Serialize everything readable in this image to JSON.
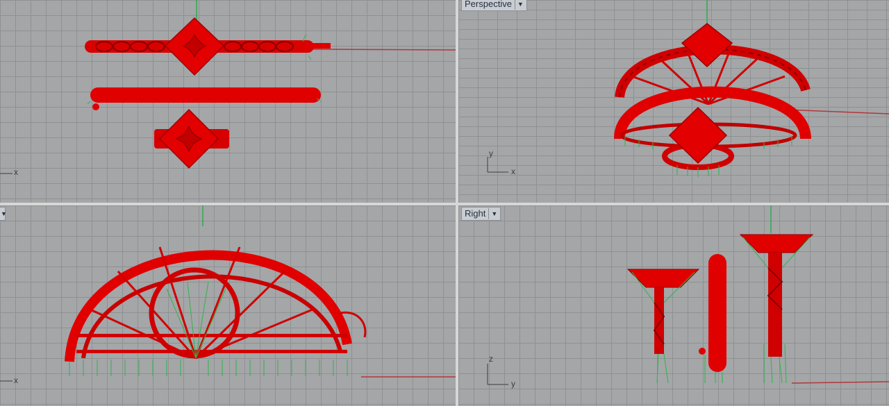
{
  "viewports": {
    "top": {
      "label": "",
      "axis_x": "x"
    },
    "perspective": {
      "label": "Perspective",
      "axis_x": "x",
      "axis_y": "y"
    },
    "front": {
      "label": "",
      "axis_x": "x"
    },
    "right": {
      "label": "Right",
      "axis_z": "z",
      "axis_y": "y"
    }
  },
  "icons": {
    "viewport_menu": "chevron-down-icon"
  },
  "colors": {
    "model": "#e00000",
    "supports": "#31b34b",
    "axis_x": "#b0383c",
    "axis_y": "#32a853",
    "grid": "#8e9092",
    "background": "#a4a6a8"
  }
}
